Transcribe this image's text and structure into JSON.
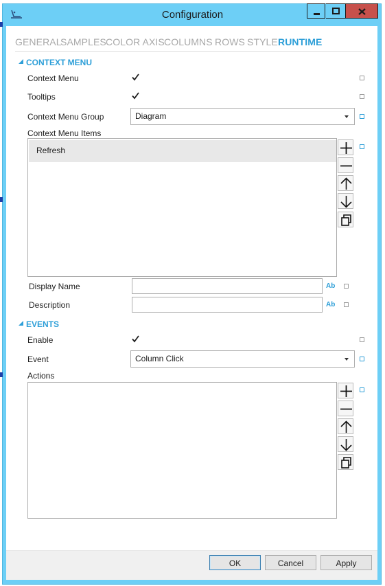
{
  "window": {
    "title": "Configuration"
  },
  "tabs": [
    {
      "label": "GENERAL"
    },
    {
      "label": "SAMPLES"
    },
    {
      "label": "COLOR AXIS"
    },
    {
      "label": "COLUMNS"
    },
    {
      "label": "ROWS"
    },
    {
      "label": "STYLE"
    },
    {
      "label": "RUNTIME"
    }
  ],
  "active_tab": "RUNTIME",
  "context_menu": {
    "header": "CONTEXT MENU",
    "context_menu_label": "Context Menu",
    "context_menu_checked": true,
    "tooltips_label": "Tooltips",
    "tooltips_checked": true,
    "group_label": "Context Menu Group",
    "group_value": "Diagram",
    "items_label": "Context Menu Items",
    "items": [
      "Refresh"
    ],
    "display_name_label": "Display Name",
    "display_name_value": "",
    "description_label": "Description",
    "description_value": "",
    "text_icon": "Ab"
  },
  "events": {
    "header": "EVENTS",
    "enable_label": "Enable",
    "enable_checked": true,
    "event_label": "Event",
    "event_value": "Column Click",
    "actions_label": "Actions",
    "actions": []
  },
  "buttons": {
    "ok": "OK",
    "cancel": "Cancel",
    "apply": "Apply"
  },
  "colors": {
    "titlebar": "#6dcff6",
    "accent": "#2e9fd8",
    "close": "#c7504b"
  }
}
